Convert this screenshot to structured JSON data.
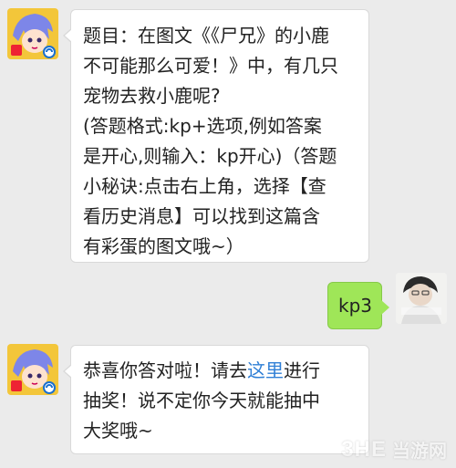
{
  "messages": {
    "question": {
      "lines": [
        "题目：在图文《《尸兄》的小鹿",
        "不可能那么可爱！》中，有几只",
        "宠物去救小鹿呢?",
        "(答题格式:kp+选项,例如答案",
        "是开心,则输入：kp开心)（答题",
        "小秘诀:点击右上角，选择【查",
        "看历史消息】可以找到这篇含",
        "有彩蛋的图文哦~）"
      ]
    },
    "reply": {
      "text": "kp3"
    },
    "result": {
      "line1_pre": "恭喜你答对啦！请去",
      "line1_link": "这里",
      "line1_post": "进行",
      "line2": "抽奖！说不定你今天就能抽中",
      "line3": "大奖哦~"
    }
  },
  "watermark": {
    "mark": "3HE",
    "text": "当游网"
  }
}
